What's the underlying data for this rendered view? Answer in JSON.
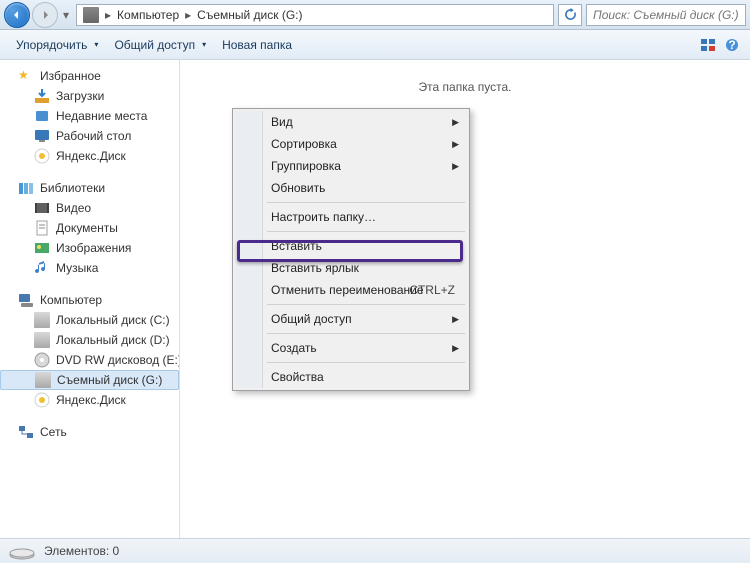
{
  "breadcrumb": {
    "sep": "▸",
    "items": [
      "Компьютер",
      "Съемный диск (G:)"
    ]
  },
  "search": {
    "placeholder": "Поиск: Съемный диск (G:)"
  },
  "toolbar": {
    "organize": "Упорядочить",
    "share": "Общий доступ",
    "newfolder": "Новая папка"
  },
  "sidebar": {
    "favorites": {
      "label": "Избранное",
      "items": [
        "Загрузки",
        "Недавние места",
        "Рабочий стол",
        "Яндекс.Диск"
      ]
    },
    "libraries": {
      "label": "Библиотеки",
      "items": [
        "Видео",
        "Документы",
        "Изображения",
        "Музыка"
      ]
    },
    "computer": {
      "label": "Компьютер",
      "items": [
        "Локальный диск (C:)",
        "Локальный диск (D:)",
        "DVD RW дисковод (E:)",
        "Съемный диск (G:)",
        "Яндекс.Диск"
      ]
    },
    "network": {
      "label": "Сеть"
    }
  },
  "content": {
    "empty": "Эта папка пуста."
  },
  "contextmenu": {
    "view": "Вид",
    "sort": "Сортировка",
    "group": "Группировка",
    "refresh": "Обновить",
    "customize": "Настроить папку…",
    "paste": "Вставить",
    "paste_shortcut": "Вставить ярлык",
    "undo_rename": "Отменить переименование",
    "undo_shortcut": "CTRL+Z",
    "share": "Общий доступ",
    "create": "Создать",
    "properties": "Свойства"
  },
  "status": {
    "items": "Элементов: 0"
  }
}
